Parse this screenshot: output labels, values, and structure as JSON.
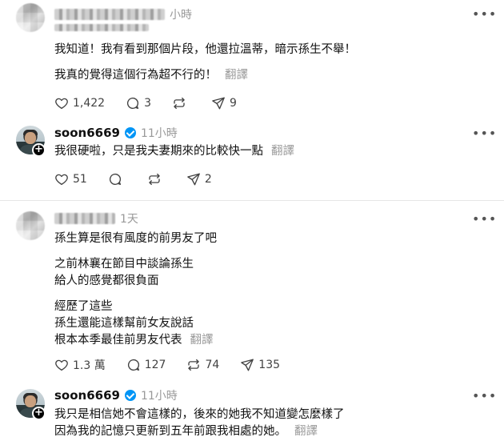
{
  "threads": [
    {
      "comment": {
        "time": "小時",
        "lines": [
          "我知道！我有看到那個片段，他還拉溫蒂，暗示孫生不舉！",
          "我真的覺得這個行為超不行的！"
        ],
        "translate": "翻譯",
        "likes": "1,422",
        "replies": "3",
        "reposts": "",
        "shares": "9"
      },
      "reply": {
        "username": "soon6669",
        "time": "11小時",
        "lines": [
          "我很硬啦，只是我夫妻期來的比較快一點"
        ],
        "translate": "翻譯",
        "likes": "51",
        "replies": "",
        "reposts": "",
        "shares": "2"
      }
    },
    {
      "comment": {
        "time": "1天",
        "lines": [
          "孫生算是很有風度的前男友了吧",
          "之前林襄在節目中談論孫生",
          "給人的感覺都很負面",
          "經歷了這些",
          "孫生還能這樣幫前女友說話",
          "根本本季最佳前男友代表"
        ],
        "translate": "翻譯",
        "likes": "1.3 萬",
        "replies": "127",
        "reposts": "74",
        "shares": "135"
      },
      "reply": {
        "username": "soon6669",
        "time": "11小時",
        "lines": [
          "我只是相信她不會這樣的，後來的她我不知道變怎麼樣了",
          "因為我的記憶只更新到五年前跟我相處的她。"
        ],
        "translate": "翻譯"
      }
    }
  ],
  "icons": {
    "like": "heart-icon",
    "reply": "comment-icon",
    "repost": "repost-icon",
    "share": "share-icon",
    "more": "more-icon",
    "verified": "verified-badge-icon",
    "follow": "plus-icon"
  },
  "colors": {
    "text": "#101010",
    "secondary": "#999999",
    "verified": "#0095f6",
    "divider": "#e6e6e6"
  }
}
